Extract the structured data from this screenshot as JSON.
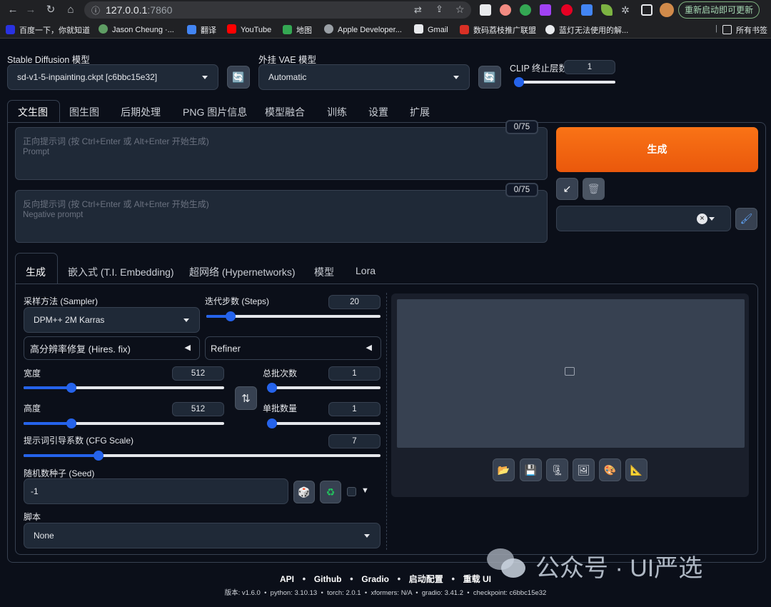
{
  "browser": {
    "url_host": "127.0.0.1",
    "url_port": ":7860",
    "update_button": "重新启动即可更新",
    "bookmarks": [
      "百度一下，你就知道",
      "Jason Cheung ·...",
      "翻译",
      "YouTube",
      "地图",
      "Apple Developer...",
      "Gmail",
      "数码荔枝推广联盟",
      "蓝灯无法使用的解..."
    ],
    "all_bookmarks": "所有书签"
  },
  "top": {
    "sd_model_label": "Stable Diffusion 模型",
    "sd_model_value": "sd-v1-5-inpainting.ckpt [c6bbc15e32]",
    "vae_label": "外挂 VAE 模型",
    "vae_value": "Automatic",
    "clip_label": "CLIP 终止层数",
    "clip_value": "1",
    "clip_fraction": 0
  },
  "main_tabs": [
    "文生图",
    "图生图",
    "后期处理",
    "PNG 图片信息",
    "模型融合",
    "训练",
    "设置",
    "扩展"
  ],
  "prompt": {
    "positive_placeholder": "正向提示词 (按 Ctrl+Enter 或 Alt+Enter 开始生成)",
    "positive_sub": "Prompt",
    "positive_count": "0/75",
    "negative_placeholder": "反向提示词 (按 Ctrl+Enter 或 Alt+Enter 开始生成)",
    "negative_sub": "Negative prompt",
    "negative_count": "0/75"
  },
  "generate_label": "生成",
  "sub_tabs": [
    "生成",
    "嵌入式 (T.I. Embedding)",
    "超网络 (Hypernetworks)",
    "模型",
    "Lora"
  ],
  "params": {
    "sampler_label": "采样方法 (Sampler)",
    "sampler_value": "DPM++ 2M Karras",
    "steps_label": "迭代步数 (Steps)",
    "steps_value": "20",
    "steps_fraction": 0.14,
    "hires_label": "高分辨率修复 (Hires. fix)",
    "refiner_label": "Refiner",
    "width_label": "宽度",
    "width_value": "512",
    "width_fraction": 0.24,
    "height_label": "高度",
    "height_value": "512",
    "height_fraction": 0.24,
    "batch_count_label": "总批次数",
    "batch_count_value": "1",
    "batch_count_fraction": 0,
    "batch_size_label": "单批数量",
    "batch_size_value": "1",
    "batch_size_fraction": 0,
    "cfg_label": "提示词引导系数 (CFG Scale)",
    "cfg_value": "7",
    "cfg_fraction": 0.21,
    "seed_label": "随机数种子 (Seed)",
    "seed_value": "-1",
    "script_label": "脚本",
    "script_value": "None"
  },
  "footer": {
    "links": [
      "API",
      "Github",
      "Gradio",
      "启动配置",
      "重载 UI"
    ],
    "version_line": "版本: v1.6.0  •  python: 3.10.13  •  torch: 2.0.1  •  xformers: N/A  •  gradio: 3.41.2  •  checkpoint: c6bbc15e32"
  },
  "watermark": "公众号 · UI严选",
  "colors": {
    "accent": "#2563eb",
    "generate": "#f97316",
    "bg": "#0b0f19"
  }
}
